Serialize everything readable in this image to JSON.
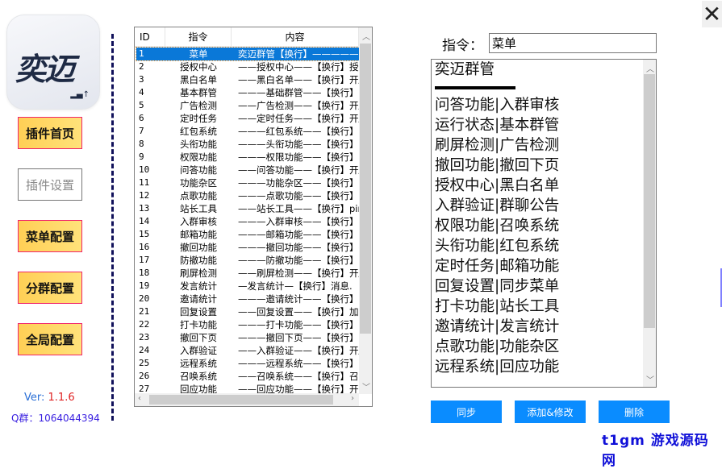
{
  "logo": {
    "text": "奕迈"
  },
  "nav": [
    "插件首页",
    "插件设置",
    "菜单配置",
    "分群配置",
    "全局配置"
  ],
  "version": {
    "label": "Ver: ",
    "value": "1.1.6"
  },
  "qq_group": "Q群：1064044394",
  "table": {
    "headers": [
      "ID",
      "指令",
      "内容"
    ],
    "selected_index": 0,
    "rows": [
      [
        "1",
        "菜单",
        "奕迈群管【换行】—————."
      ],
      [
        "2",
        "授权中心",
        "——授权中心——【换行】授."
      ],
      [
        "3",
        "黑白名单",
        "——黑白名单——【换行】开/"
      ],
      [
        "4",
        "基本群管",
        "———基础群管——【换行】."
      ],
      [
        "5",
        "广告检测",
        "——广告检测——【换行】开/"
      ],
      [
        "6",
        "定时任务",
        "——定时任务——【换行】开/"
      ],
      [
        "7",
        "红包系统",
        "———红包系统——【换行】."
      ],
      [
        "8",
        "头衔功能",
        "———头衔功能——【换行】我."
      ],
      [
        "9",
        "权限功能",
        "———权限功能——【换行】我."
      ],
      [
        "10",
        "问答功能",
        "——问答功能——【换行】开/"
      ],
      [
        "11",
        "功能杂区",
        "———功能杂区——【换行】清."
      ],
      [
        "12",
        "点歌功能",
        "———点歌功能——【换行】QQ."
      ],
      [
        "13",
        "站长工具",
        "——站长工具——【换行】pin"
      ],
      [
        "14",
        "入群审核",
        "———入群审核——【换行】."
      ],
      [
        "15",
        "邮箱功能",
        "———邮箱功能——【换行】【."
      ],
      [
        "16",
        "撤回功能",
        "———撤回功能——【换行】撤."
      ],
      [
        "17",
        "防撤功能",
        "———防撤功能——【换行】开."
      ],
      [
        "18",
        "刷屏检测",
        "——刷屏检测——【换行】开/"
      ],
      [
        "19",
        "发言统计",
        "—发言统计—【换行】消息."
      ],
      [
        "20",
        "邀请统计",
        "———邀请统计——【换行】开/"
      ],
      [
        "21",
        "回复设置",
        "——回复设置——【换行】加Q"
      ],
      [
        "22",
        "打卡功能",
        "———打卡功能——【换行】."
      ],
      [
        "23",
        "撤回下页",
        "———撤回下页——【换行】开."
      ],
      [
        "24",
        "入群验证",
        "——入群验证——【换行】开/"
      ],
      [
        "25",
        "远程系统",
        "———远程系统——【换行】."
      ],
      [
        "26",
        "召唤系统",
        "——召唤系统——【换行】召."
      ],
      [
        "27",
        "回应功能",
        "——回应功能——【换行】开."
      ]
    ]
  },
  "editor": {
    "label": "指令：",
    "command": "菜单",
    "title": "奕迈群管",
    "lines": [
      "问答功能|入群审核",
      "运行状态|基本群管",
      "刷屏检测|广告检测",
      "撤回功能|撤回下页",
      "授权中心|黑白名单",
      "入群验证|群聊公告",
      "权限功能|召唤系统",
      "头衔功能|红包系统",
      "定时任务|邮箱功能",
      "回复设置|同步菜单",
      "打卡功能|站长工具",
      "邀请统计|发言统计",
      "点歌功能|功能杂区",
      "远程系统|回应功能"
    ]
  },
  "buttons": {
    "sync": "同步",
    "add": "添加&修改",
    "delete": "删除"
  },
  "close": "✕",
  "watermark": "t1gm 游戏源码网"
}
